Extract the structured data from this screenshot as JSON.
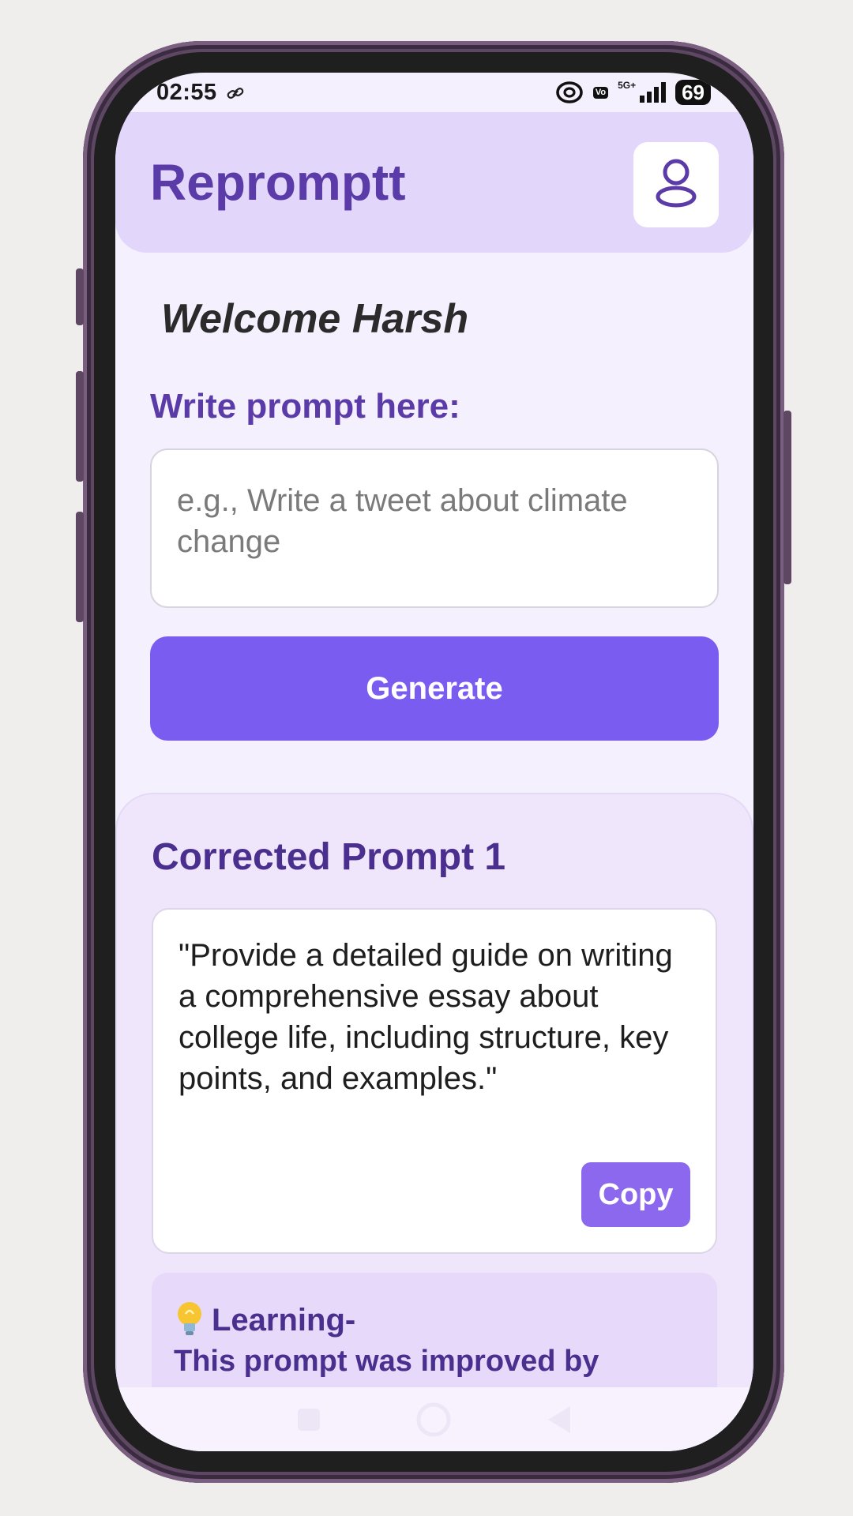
{
  "status_bar": {
    "time": "02:55",
    "net_badge": "Vo",
    "net_type": "5G+",
    "battery": "69"
  },
  "header": {
    "title": "Repromptt",
    "profile_icon": "user-icon"
  },
  "welcome": "Welcome Harsh",
  "prompt": {
    "label": "Write prompt here:",
    "value": "",
    "placeholder": "e.g., Write a tweet about climate change",
    "generate_label": "Generate"
  },
  "result": {
    "title": "Corrected Prompt 1",
    "text": "\"Provide a detailed guide on writing a comprehensive essay about college life, including structure, key points, and examples.\"",
    "copy_label": "Copy"
  },
  "learning": {
    "icon": "lightbulb-icon",
    "title": "Learning-",
    "text": "This prompt was improved by specifying the focus on college"
  },
  "nav": {
    "icons": [
      "recents-icon",
      "home-icon",
      "back-icon"
    ]
  },
  "colors": {
    "brand_purple": "#5a3ba8",
    "button_purple": "#7a5cf0",
    "header_bg": "#e3d6fb",
    "screen_bg": "#f5f0fe"
  }
}
